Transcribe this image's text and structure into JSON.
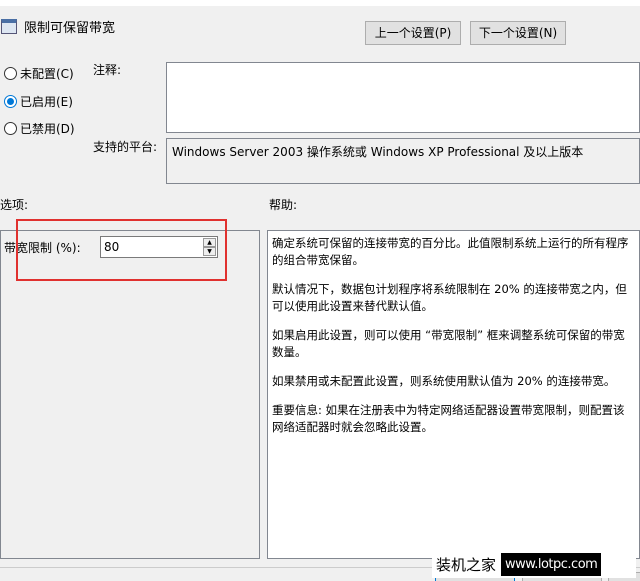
{
  "title": "限制可保留带宽",
  "nav": {
    "prev": "上一个设置(P)",
    "next": "下一个设置(N)"
  },
  "radios": [
    {
      "label": "未配置(C)",
      "checked": false
    },
    {
      "label": "已启用(E)",
      "checked": true
    },
    {
      "label": "已禁用(D)",
      "checked": false
    }
  ],
  "comment_label": "注释:",
  "comment_value": "",
  "platform_label": "支持的平台:",
  "platform_value": "Windows Server 2003 操作系统或 Windows XP Professional 及以上版本",
  "options_label": "选项:",
  "help_label": "帮助:",
  "option": {
    "label": "带宽限制 (%):",
    "value": "80"
  },
  "help": [
    "确定系统可保留的连接带宽的百分比。此值限制系统上运行的所有程序的组合带宽保留。",
    "默认情况下，数据包计划程序将系统限制在 20% 的连接带宽之内，但可以使用此设置来替代默认值。",
    "如果启用此设置，则可以使用 “带宽限制” 框来调整系统可保留的带宽数量。",
    "如果禁用或未配置此设置，则系统使用默认值为 20% 的连接带宽。",
    "重要信息: 如果在注册表中为特定网络适配器设置带宽限制，则配置该网络适配器时就会忽略此设置。"
  ],
  "watermark": {
    "cn": "装机之家",
    "url": "www.lotpc.com"
  },
  "colors": {
    "highlight": "#e0312f",
    "accent": "#0078d7"
  }
}
